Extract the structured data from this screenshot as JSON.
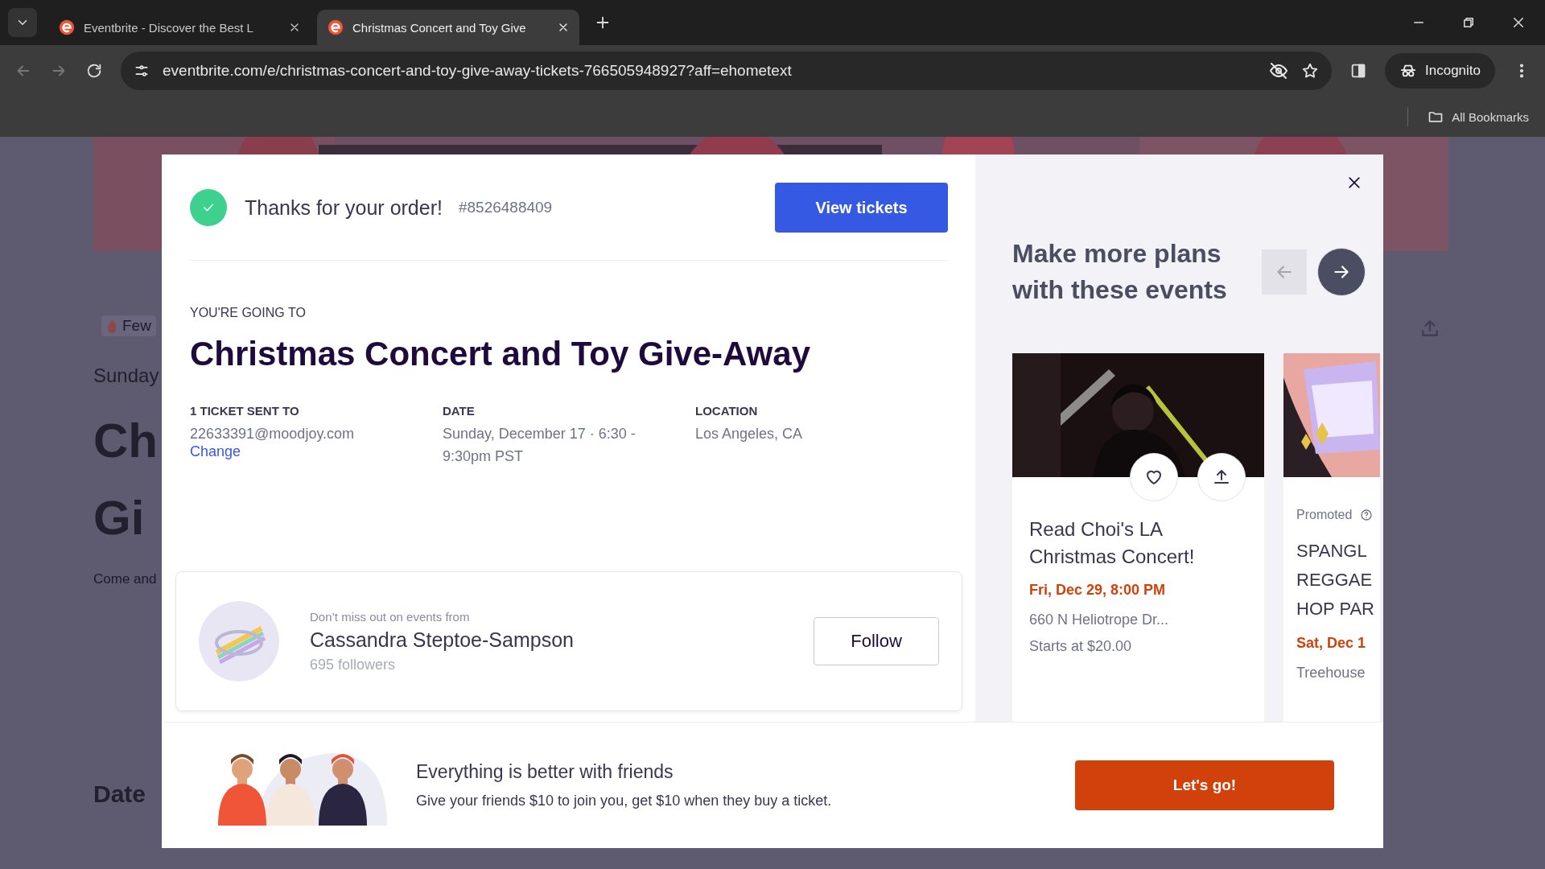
{
  "browser": {
    "tabs": [
      {
        "title": "Eventbrite - Discover the Best L",
        "selected": false
      },
      {
        "title": "Christmas Concert and Toy Give",
        "selected": true
      }
    ],
    "url": "eventbrite.com/e/christmas-concert-and-toy-give-away-tickets-766505948927?aff=ehometext",
    "profile_label": "Incognito",
    "bookmarks_label": "All Bookmarks"
  },
  "background_page": {
    "badge": "Few",
    "day": "Sunday",
    "title_lines": [
      "Ch",
      "Gi"
    ],
    "description": "Come and",
    "section_heading": "Date"
  },
  "order_modal": {
    "header": {
      "message": "Thanks for your order!",
      "order_number": "#8526488409",
      "view_button": "View tickets"
    },
    "event": {
      "eyebrow": "YOU'RE GOING TO",
      "title": "Christmas Concert and Toy Give-Away"
    },
    "details": [
      {
        "label": "1 TICKET SENT TO",
        "value": "22633391@moodjoy.com",
        "link": "Change"
      },
      {
        "label": "DATE",
        "value": "Sunday, December 17 · 6:30 - 9:30pm PST"
      },
      {
        "label": "LOCATION",
        "value": "Los Angeles, CA"
      }
    ],
    "organizer": {
      "eyebrow": "Don’t miss out on events from",
      "name": "Cassandra Steptoe-Sampson",
      "followers": "695 followers",
      "follow_button": "Follow"
    },
    "recommendations": {
      "heading": "Make more plans with these events",
      "prev": {
        "disabled": true
      },
      "next": {
        "disabled": false
      },
      "events": [
        {
          "kind": "card",
          "title": "Read Choi's LA Christmas Concert!",
          "date": "Fri, Dec 29, 8:00 PM",
          "address": "660 N Heliotrope Dr...",
          "price": "Starts at $20.00"
        },
        {
          "kind": "peek",
          "promoted_label": "Promoted",
          "title": "SPANGL\nREGGAE\nHOP PAR",
          "date": "Sat, Dec 1",
          "address": "Treehouse"
        }
      ]
    },
    "banner": {
      "title": "Everything is better with friends",
      "text": "Give your friends $10 to join you, get $10 when they buy a ticket.",
      "button": "Let's go!"
    }
  }
}
